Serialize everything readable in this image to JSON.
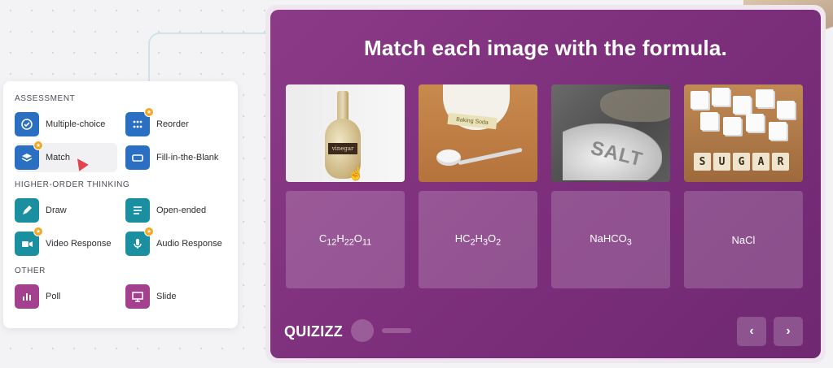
{
  "panel": {
    "sections": [
      {
        "title": "ASSESSMENT",
        "items": [
          {
            "label": "Multiple-choice",
            "icon": "check-circle-icon",
            "color": "blue",
            "badge": false
          },
          {
            "label": "Reorder",
            "icon": "grid-dots-icon",
            "color": "blue",
            "badge": true
          },
          {
            "label": "Match",
            "icon": "layers-icon",
            "color": "blue",
            "badge": true
          },
          {
            "label": "Fill-in-the-Blank",
            "icon": "input-box-icon",
            "color": "blue",
            "badge": false
          }
        ]
      },
      {
        "title": "HIGHER-ORDER THINKING",
        "items": [
          {
            "label": "Draw",
            "icon": "pencil-icon",
            "color": "teal",
            "badge": false
          },
          {
            "label": "Open-ended",
            "icon": "text-lines-icon",
            "color": "teal",
            "badge": false
          },
          {
            "label": "Video Response",
            "icon": "video-camera-icon",
            "color": "teal",
            "badge": true
          },
          {
            "label": "Audio Response",
            "icon": "microphone-icon",
            "color": "teal",
            "badge": true
          }
        ]
      },
      {
        "title": "OTHER",
        "items": [
          {
            "label": "Poll",
            "icon": "bar-chart-icon",
            "color": "purple",
            "badge": false
          },
          {
            "label": "Slide",
            "icon": "presentation-icon",
            "color": "purple",
            "badge": false
          }
        ]
      }
    ]
  },
  "card": {
    "title": "Match each image with the formula.",
    "images": [
      {
        "label": "vinegar"
      },
      {
        "label": "Baking Soda"
      },
      {
        "label": "SALT"
      },
      {
        "letters": [
          "S",
          "U",
          "G",
          "A",
          "R"
        ]
      }
    ],
    "answers": [
      {
        "main": [
          "C",
          "H",
          "O"
        ],
        "subs": [
          "12",
          "22",
          "11"
        ]
      },
      {
        "main": [
          "HC",
          "H",
          "O"
        ],
        "subs": [
          "2",
          "3",
          "2"
        ]
      },
      {
        "main": [
          "NaHCO"
        ],
        "subs": [
          "3"
        ]
      },
      {
        "main": [
          "NaCl"
        ],
        "subs": []
      }
    ],
    "logo": "QUIZIZZ",
    "prev_label": "‹",
    "next_label": "›"
  },
  "colors": {
    "card_purple": "#7d2f7c",
    "blue": "#2a6fc2",
    "teal": "#1a8f9f",
    "purple": "#a3418f",
    "badge": "#f5a623"
  }
}
